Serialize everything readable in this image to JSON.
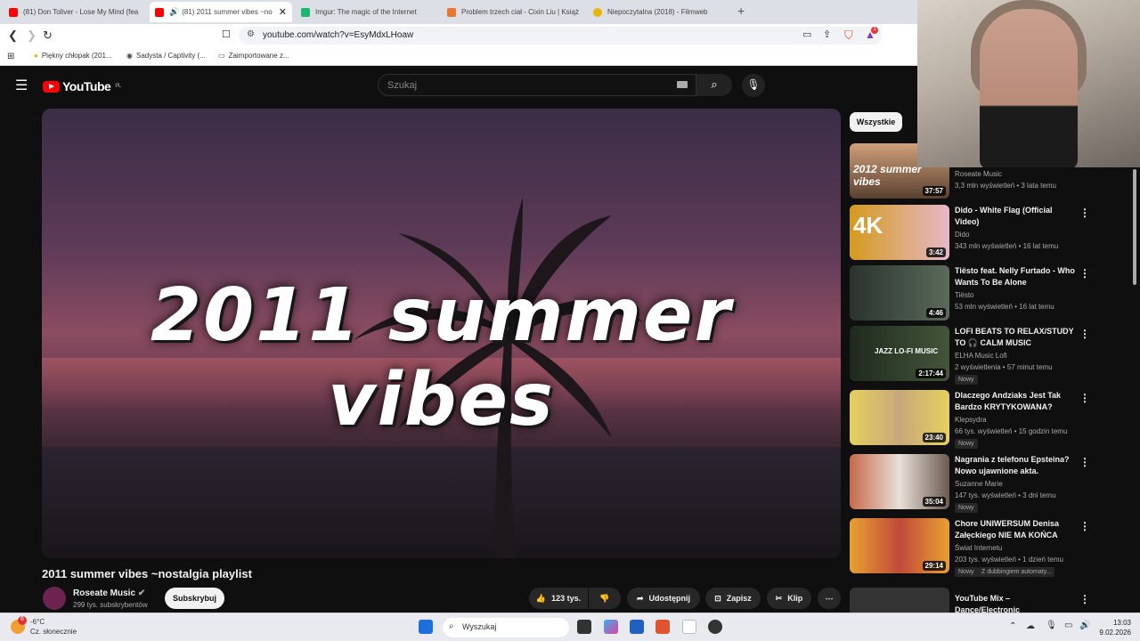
{
  "browser": {
    "tabs": [
      {
        "label": "(81) Don Toliver - Lose My Mind (fea",
        "favicon_color": "#ff0000"
      },
      {
        "label": "(81) 2011 summer vibes ~no",
        "favicon_color": "#ff0000",
        "active": true
      },
      {
        "label": "Imgur: The magic of the Internet",
        "favicon_color": "#1bb76e"
      },
      {
        "label": "Problem trzech ciał - Cixin Liu | Książ",
        "favicon_color": "#e8762c"
      },
      {
        "label": "Niepoczytalna (2018) - Filmweb",
        "favicon_color": "#e8b800"
      }
    ],
    "url": "youtube.com/watch?v=EsyMdxLHoaw",
    "bookmarks": [
      "Piękny chłopak (201...",
      "Sadysta / Captivity (...",
      "Zaimportowane z..."
    ],
    "extension_badge": "1"
  },
  "youtube": {
    "logo": "YouTube",
    "region": "PL",
    "search_placeholder": "Szukaj",
    "video_overlay_title": "2011 summer vibes",
    "video_title": "2011 summer vibes ~nostalgia playlist",
    "channel": "Roseate Music",
    "subscribers": "299 tys. subskrybentów",
    "subscribe_label": "Subskrybuj",
    "likes": "123 tys.",
    "share_label": "Udostępnij",
    "save_label": "Zapisz",
    "clip_label": "Klip",
    "filter_chip": "Wszystkie",
    "recommendations": [
      {
        "title": "",
        "thumb_text": "2012 summer vibes",
        "channel": "Roseate Music",
        "meta": "3,3 mln wyświetleń • 3 lata temu",
        "duration": "37:57",
        "thumb_color": "#7a5a4a"
      },
      {
        "title": "Dido - White Flag (Official Video)",
        "thumb_text": "4K",
        "channel": "Dido",
        "meta": "343 mln wyświetleń • 16 lat temu",
        "duration": "3:42",
        "thumb_color": "#c89a2a"
      },
      {
        "title": "Tiësto feat. Nelly Furtado - Who Wants To Be Alone",
        "thumb_text": "",
        "channel": "Tiësto",
        "meta": "53 mln wyświetleń • 16 lat temu",
        "duration": "4:46",
        "thumb_color": "#3a4a40"
      },
      {
        "title": "LOFI BEATS TO RELAX/STUDY TO 🎧 CALM MUSIC",
        "thumb_text": "JAZZ LO-FI MUSIC",
        "channel": "ELHA Music Lofi",
        "meta": "2 wyświetlenia • 57 minut temu",
        "badge": "Nowy",
        "duration": "2:17:44",
        "thumb_color": "#2f3b2a"
      },
      {
        "title": "Dlaczego Andziaks Jest Tak Bardzo KRYTYKOWANA?",
        "thumb_text": "",
        "channel": "Klepsydra",
        "meta": "66 tys. wyświetleń • 15 godzin temu",
        "badge": "Nowy",
        "duration": "23:40",
        "thumb_color": "#d8c25a"
      },
      {
        "title": "Nagrania z telefonu Epsteina? Nowo ujawnione akta.",
        "thumb_text": "",
        "channel": "Suzanne Marie",
        "meta": "147 tys. wyświetleń • 3 dni temu",
        "badge": "Nowy",
        "duration": "35:04",
        "thumb_color": "#8a6a5a"
      },
      {
        "title": "Chore UNIWERSUM Denisa Załęckiego NIE MA KOŃCA",
        "thumb_text": "",
        "channel": "Świat Internetu",
        "meta": "203 tys. wyświetleń • 1 dzień temu",
        "badge": "Nowy",
        "extra_badge": "Z dubbingiem automaty...",
        "duration": "29:14",
        "thumb_color": "#c06a30"
      },
      {
        "title": "YouTube Mix – Dance/Electronic",
        "thumb_text": "",
        "channel": "",
        "meta": "",
        "duration": "",
        "thumb_color": "#333333"
      }
    ]
  },
  "taskbar": {
    "weather_temp": "-6°C",
    "weather_desc": "Cz. słonecznie",
    "notif_count": "6",
    "search_placeholder": "Wyszukaj",
    "time": "13:03",
    "date": "9.02.2026"
  }
}
